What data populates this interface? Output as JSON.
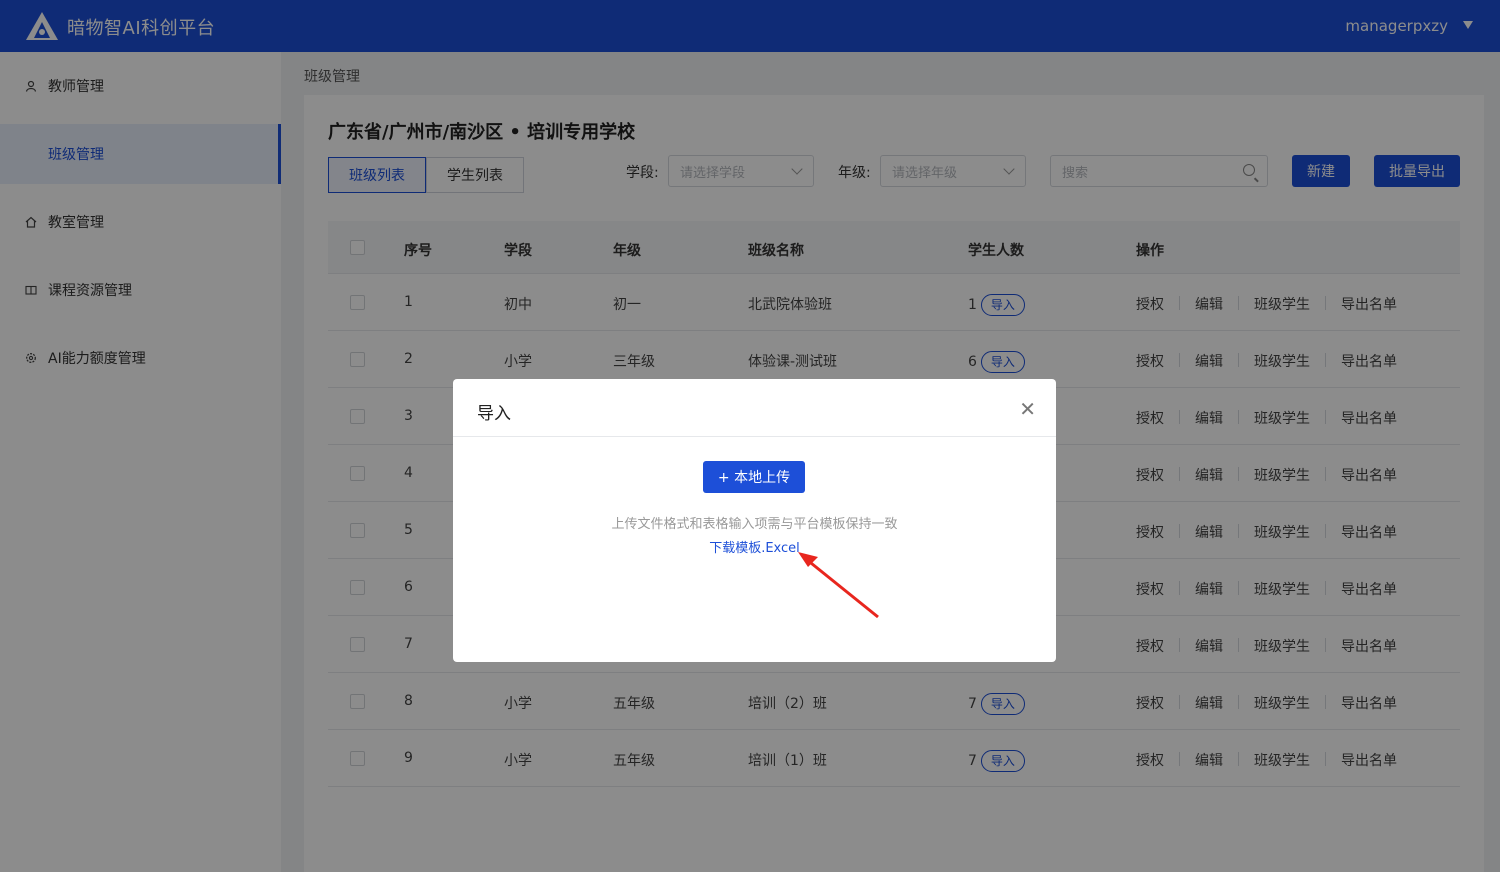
{
  "header": {
    "brand": "暗物智AI科创平台",
    "user": "managerpxzy"
  },
  "sidebar": {
    "items": [
      {
        "label": "教师管理",
        "icon": "user-icon"
      },
      {
        "label": "班级管理",
        "icon": ""
      },
      {
        "label": "教室管理",
        "icon": "home-icon"
      },
      {
        "label": "课程资源管理",
        "icon": "book-icon"
      },
      {
        "label": "AI能力额度管理",
        "icon": "gear-icon"
      }
    ]
  },
  "breadcrumb": "班级管理",
  "school_title": "广东省/广州市/南沙区 • 培训专用学校",
  "tabs": [
    "班级列表",
    "学生列表"
  ],
  "filters": {
    "stage_label": "学段:",
    "stage_placeholder": "请选择学段",
    "grade_label": "年级:",
    "grade_placeholder": "请选择年级",
    "search_placeholder": "搜索"
  },
  "buttons": {
    "new": "新建",
    "export": "批量导出"
  },
  "table": {
    "columns": [
      "序号",
      "学段",
      "年级",
      "班级名称",
      "学生人数",
      "操作"
    ],
    "rows": [
      {
        "no": "1",
        "stage": "初中",
        "grade": "初一",
        "name": "北武院体验班",
        "count": "1"
      },
      {
        "no": "2",
        "stage": "小学",
        "grade": "三年级",
        "name": "体验课-测试班",
        "count": "6"
      },
      {
        "no": "3",
        "stage": "",
        "grade": "",
        "name": "",
        "count": ""
      },
      {
        "no": "4",
        "stage": "",
        "grade": "",
        "name": "",
        "count": ""
      },
      {
        "no": "5",
        "stage": "",
        "grade": "",
        "name": "",
        "count": ""
      },
      {
        "no": "6",
        "stage": "",
        "grade": "",
        "name": "",
        "count": ""
      },
      {
        "no": "7",
        "stage": "",
        "grade": "",
        "name": "",
        "count": ""
      },
      {
        "no": "8",
        "stage": "小学",
        "grade": "五年级",
        "name": "培训（2）班",
        "count": "7"
      },
      {
        "no": "9",
        "stage": "小学",
        "grade": "五年级",
        "name": "培训（1）班",
        "count": "7"
      }
    ],
    "import_label": "导入",
    "ops": [
      "授权",
      "编辑",
      "班级学生",
      "导出名单"
    ]
  },
  "modal": {
    "title": "导入",
    "upload_button": "+ 本地上传",
    "hint": "上传文件格式和表格输入项需与平台模板保持一致",
    "download_link": "下载模板.Excel"
  },
  "colors": {
    "primary": "#1d4fd8",
    "annotation_arrow": "#e8261e"
  }
}
